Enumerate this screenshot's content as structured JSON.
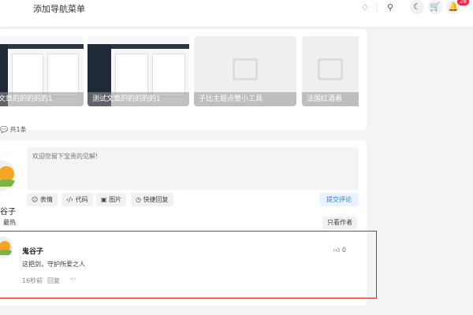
{
  "header": {
    "nav_title": "添加导航菜单",
    "notification_count": "28",
    "icons": [
      "badge-icon",
      "search-icon",
      "moon-icon",
      "cart-icon",
      "bell-icon"
    ]
  },
  "gallery": [
    {
      "caption": "文章的的的的的1",
      "image": "screenshot"
    },
    {
      "caption": "测试文章的的的的的1",
      "image": "screenshot"
    },
    {
      "caption": "子比主题点赞小工具",
      "image": "placeholder"
    },
    {
      "caption": "法国红酒看",
      "image": "placeholder"
    }
  ],
  "comments": {
    "count_label": "共1条",
    "current_user": "谷子",
    "placeholder": "欢迎您留下宝贵的见解!",
    "toolbar": {
      "emoji": "表情",
      "code": "代码",
      "image": "图片",
      "quick_reply": "快捷回复"
    },
    "submit": "提交评论",
    "sort_hot": "最热",
    "author_only": "只看作者",
    "items": [
      {
        "author": "鬼谷子",
        "text": "这把剑，守护所爱之人",
        "time": "16秒前",
        "reply": "回复",
        "likes": "0",
        "more": "···"
      }
    ]
  },
  "colors": {
    "accent": "#2a7de1",
    "highlight_border": "#e02020",
    "badge": "#f3243f"
  }
}
